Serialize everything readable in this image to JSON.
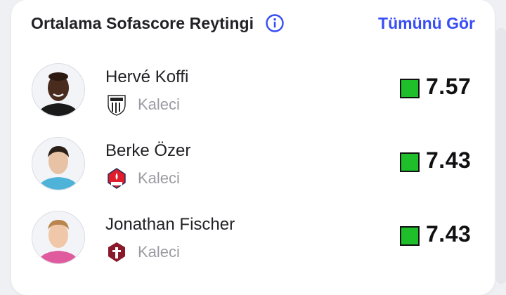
{
  "header": {
    "title": "Ortalama Sofascore Reytingi",
    "see_all": "Tümünü Gör",
    "info_icon": "info-icon",
    "accent_color": "#374df5"
  },
  "players": [
    {
      "name": "Hervé Koffi",
      "position": "Kaleci",
      "rating": "7.57",
      "rating_color": "#1fbf2c",
      "team_icon": "sco-angers-crest"
    },
    {
      "name": "Berke Özer",
      "position": "Kaleci",
      "rating": "7.43",
      "rating_color": "#1fbf2c",
      "team_icon": "losc-lille-crest"
    },
    {
      "name": "Jonathan Fischer",
      "position": "Kaleci",
      "rating": "7.43",
      "rating_color": "#1fbf2c",
      "team_icon": "fc-metz-crest"
    }
  ]
}
